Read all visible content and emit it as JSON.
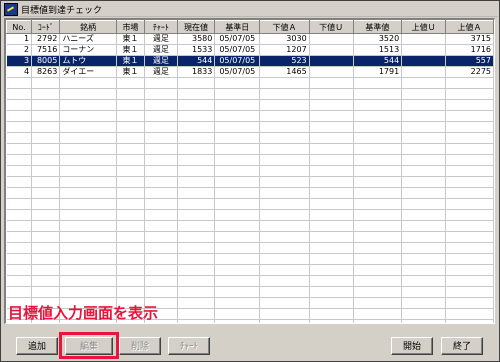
{
  "window": {
    "title": "目標値到達チェック"
  },
  "table": {
    "headers": [
      "No.",
      "ｺｰﾄﾞ",
      "銘柄",
      "市場",
      "ﾁｬｰﾄ",
      "現在値",
      "基準日",
      "下値Ａ",
      "下値Ｕ",
      "基準値",
      "上値Ｕ",
      "上値Ａ"
    ],
    "rows": [
      [
        "1",
        "2792",
        "ハニーズ",
        "東１",
        "週足",
        "3580",
        "05/07/05",
        "3030",
        "",
        "3520",
        "",
        "3715"
      ],
      [
        "2",
        "7516",
        "コーナン",
        "東１",
        "週足",
        "1533",
        "05/07/05",
        "1207",
        "",
        "1513",
        "",
        "1716"
      ],
      [
        "3",
        "8005",
        "ムトウ",
        "東１",
        "週足",
        "544",
        "05/07/05",
        "523",
        "",
        "544",
        "",
        "557"
      ],
      [
        "4",
        "8263",
        "ダイエー",
        "東１",
        "週足",
        "1833",
        "05/07/05",
        "1465",
        "",
        "1791",
        "",
        "2275"
      ]
    ],
    "selected_row_index": 2
  },
  "annotation": {
    "text": "目標値入力画面を表示"
  },
  "buttons": {
    "add": "追加",
    "edit": "編集",
    "delete": "削除",
    "chart": "ﾁｬｰﾄ",
    "start": "開始",
    "exit": "終了"
  },
  "colors": {
    "selection": "#0a246a",
    "annotation": "#e8143c"
  }
}
